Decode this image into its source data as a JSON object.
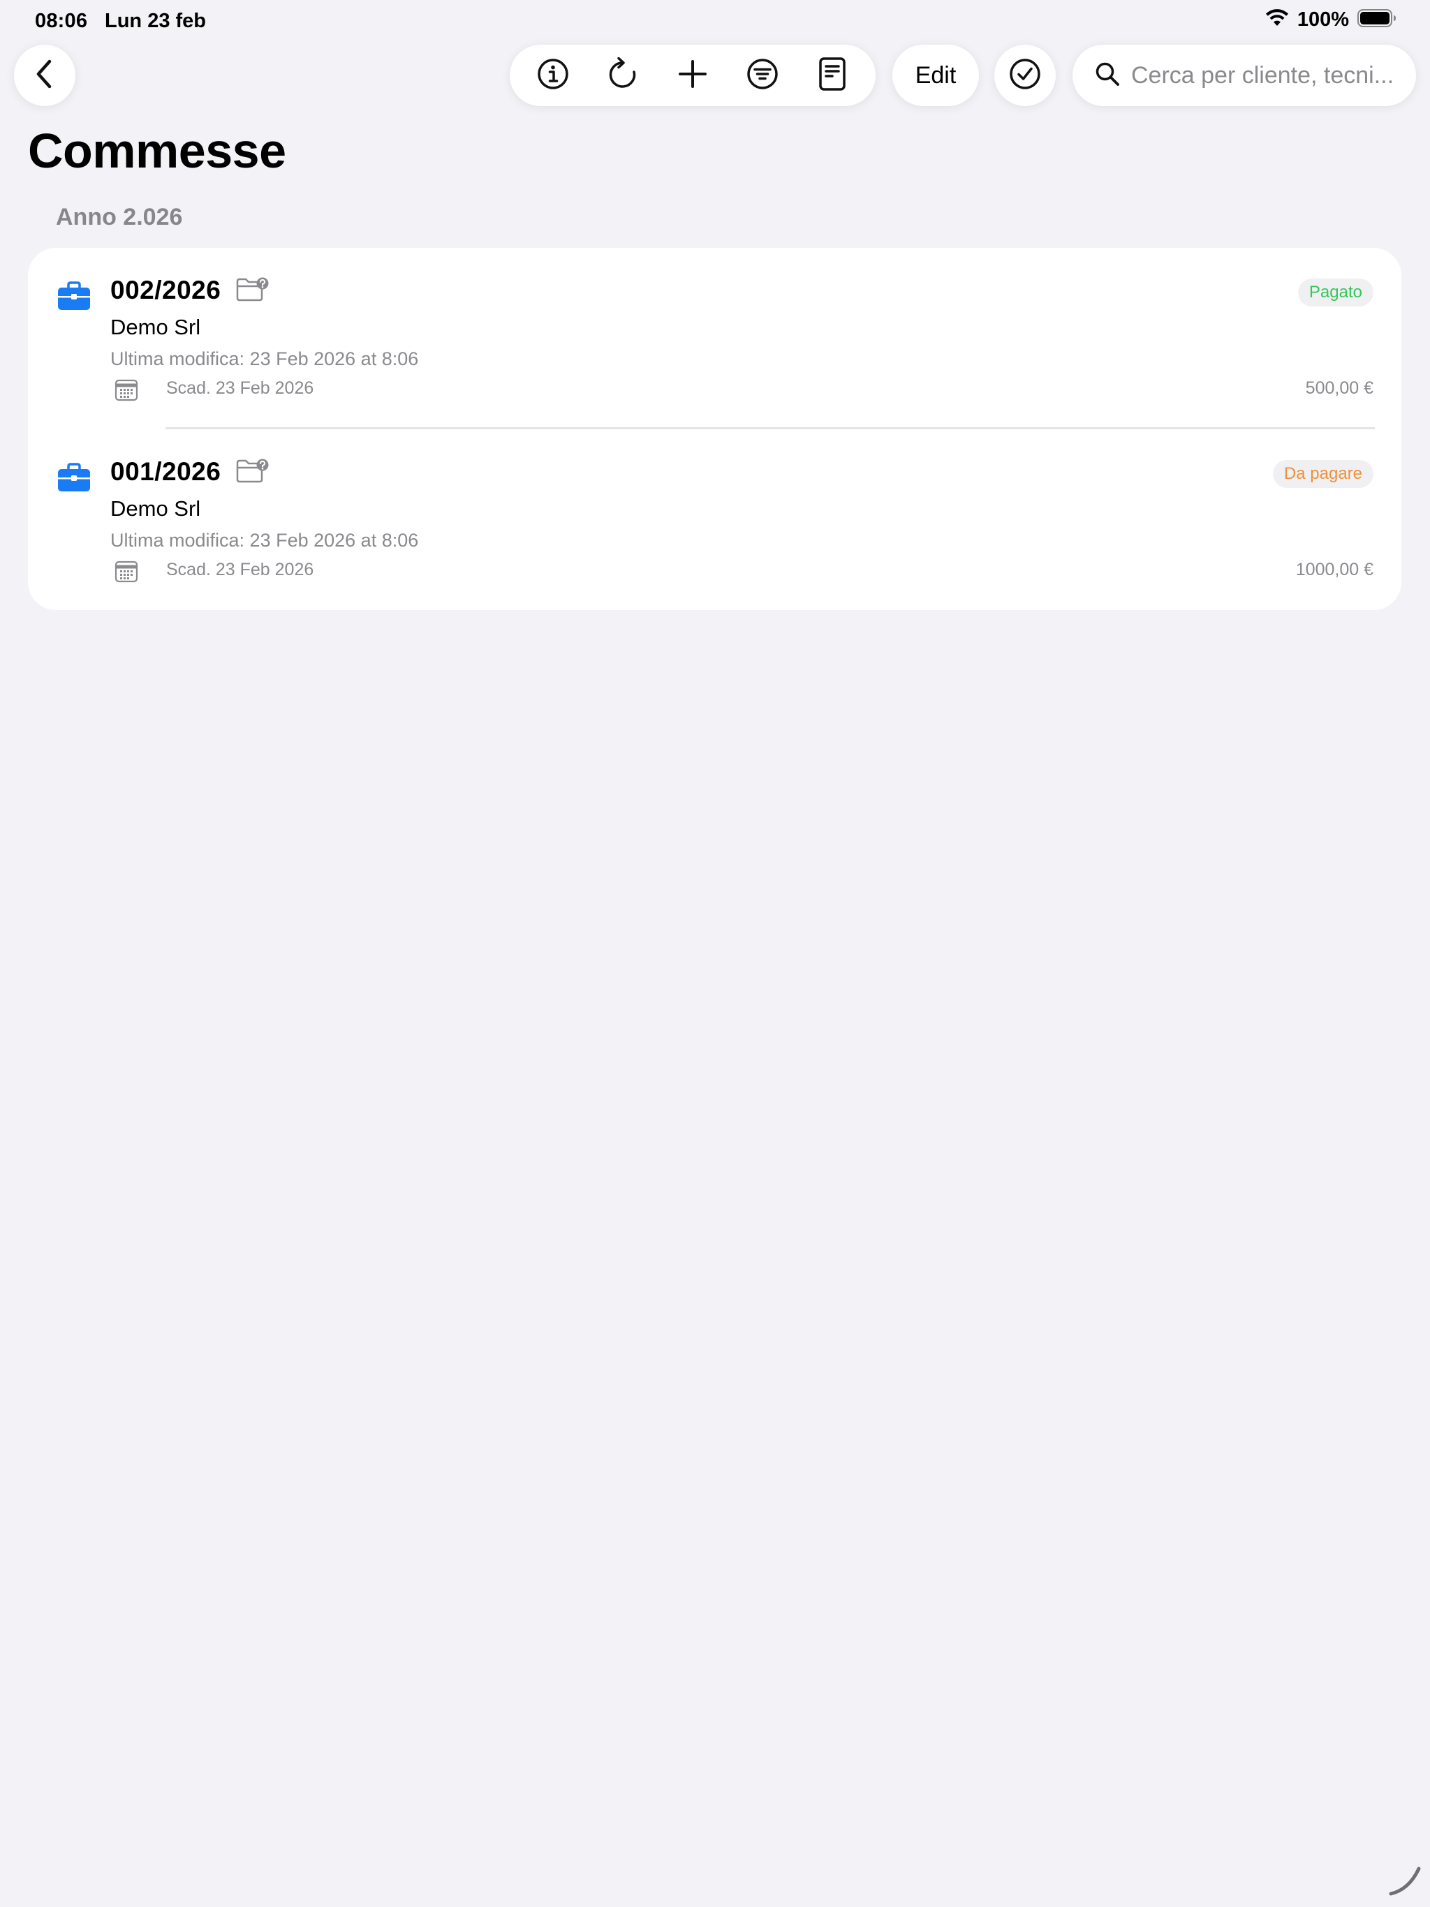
{
  "status_bar": {
    "time": "08:06",
    "date": "Lun 23 feb",
    "battery": "100%"
  },
  "nav": {
    "edit_label": "Edit",
    "search_placeholder": "Cerca per cliente, tecni..."
  },
  "page": {
    "title": "Commesse",
    "section": "Anno 2.026"
  },
  "colors": {
    "accent": "#1a7cf5",
    "paid": "#34c759",
    "due": "#f0903a",
    "background": "#f2f2f7"
  },
  "orders": [
    {
      "number": "002/2026",
      "client": "Demo Srl",
      "modified": "Ultima modifica: 23 Feb 2026 at 8:06",
      "due": "Scad. 23 Feb 2026",
      "amount": "500,00 €",
      "status": "Pagato"
    },
    {
      "number": "001/2026",
      "client": "Demo Srl",
      "modified": "Ultima modifica: 23 Feb 2026 at 8:06",
      "due": "Scad. 23 Feb 2026",
      "amount": "1000,00 €",
      "status": "Da pagare"
    }
  ]
}
